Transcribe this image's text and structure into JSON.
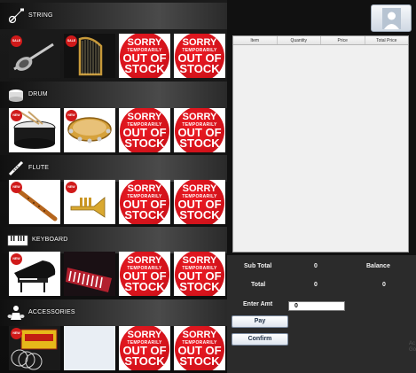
{
  "categories": [
    {
      "key": "string",
      "label": "STRING",
      "icon": "guitar-icon"
    },
    {
      "key": "drum",
      "label": "DRUM",
      "icon": "drum-icon"
    },
    {
      "key": "flute",
      "label": "FLUTE",
      "icon": "flute-icon"
    },
    {
      "key": "keyboard",
      "label": "KEYBOARD",
      "icon": "keyboard-icon"
    },
    {
      "key": "accessories",
      "label": "ACCESSORIES",
      "icon": "drum-set-icon"
    }
  ],
  "out_of_stock": {
    "line1": "SORRY",
    "line2": "TEMPORARILY",
    "line3": "OUT OF",
    "line4": "STOCK"
  },
  "sale_badge": "SALE",
  "new_badge": "NEW",
  "table": {
    "columns": [
      "Item",
      "Quantity",
      "Price",
      "Total Price"
    ]
  },
  "bill": {
    "sub_total_label": "Sub Total",
    "sub_total_value": "0",
    "balance_label": "Balance",
    "total_label": "Total",
    "total_value": "0",
    "balance_value": "0",
    "enter_amt_label": "Enter Amt",
    "enter_amt_value": "0",
    "pay_label": "Pay",
    "confirm_label": "Confirm"
  },
  "watermark": "Ac\nGo",
  "colors": {
    "out_of_stock_red": "#e11b22",
    "panel_dark": "#2b2b2b",
    "table_bg": "#f0f0f0"
  }
}
